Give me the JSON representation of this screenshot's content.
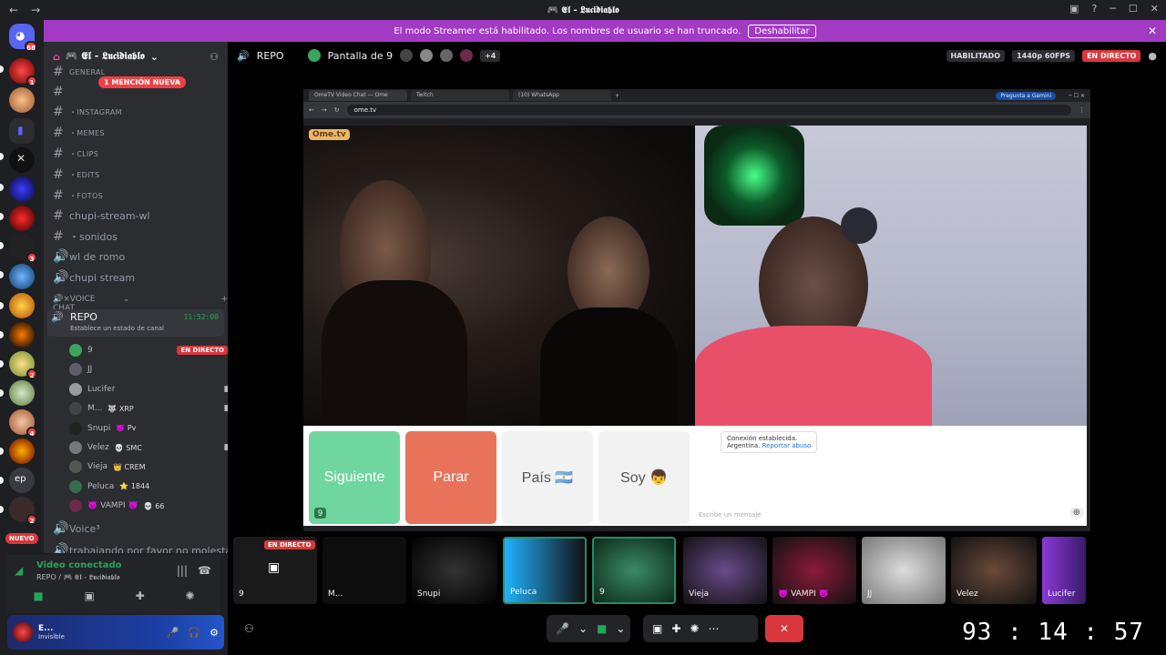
{
  "window": {
    "title": "🎮 𝕰𝖑 - 𝕷𝖚𝖈𝖎𝖉𝖎𝖆𝖇𝖑𝖔",
    "back": "←",
    "forward": "→"
  },
  "banner": {
    "text": "El modo Streamer está habilitado. Los nombres de usuario se han truncado.",
    "button": "Deshabilitar"
  },
  "rail": {
    "dm_badge": "68",
    "new_label": "NUEVO"
  },
  "guild": {
    "name": "🎮 𝕰𝖑 - 𝕷𝖚𝖈𝖎𝖉𝖎𝖆𝖇𝖑𝖔"
  },
  "mention_pill": "1 MENCIÓN NUEVA",
  "channels": [
    {
      "label": "GENERAL",
      "kind": "text",
      "small": true
    },
    {
      "label": "",
      "kind": "text",
      "small": true
    },
    {
      "label": "・INSTAGRAM",
      "kind": "text",
      "small": true
    },
    {
      "label": "・MEMES",
      "kind": "text",
      "small": true
    },
    {
      "label": "・CLIPS",
      "kind": "text",
      "small": true
    },
    {
      "label": "・EDITS",
      "kind": "text",
      "small": true
    },
    {
      "label": "・FOTOS",
      "kind": "text",
      "small": true
    },
    {
      "label": "chupi-stream-wl",
      "kind": "text",
      "small": false
    },
    {
      "label": "・sonidos",
      "kind": "text",
      "small": false
    },
    {
      "label": "wl de romo",
      "kind": "voice",
      "small": false
    },
    {
      "label": "chupi stream",
      "kind": "voice",
      "small": false
    }
  ],
  "voice_category": "🔊×VOICE CHAT",
  "active_voice": {
    "name": "REPO",
    "time": "11:52:00",
    "status": "Establece un estado de canal"
  },
  "members": [
    {
      "name": "9",
      "tag": "",
      "live": "EN DIRECTO",
      "cam": false,
      "color": "#3ba55c"
    },
    {
      "name": "JJ",
      "tag": "",
      "live": "",
      "cam": false,
      "color": "#5d6068"
    },
    {
      "name": "Lucifer",
      "tag": "",
      "live": "",
      "cam": true,
      "color": "#9a9aa0"
    },
    {
      "name": "M...",
      "tag": "🐺 XRP",
      "live": "",
      "cam": true,
      "color": "#444"
    },
    {
      "name": "Snupi",
      "tag": "👿 Pv",
      "live": "",
      "cam": false,
      "color": "#222"
    },
    {
      "name": "Velez",
      "tag": "💀 SMC",
      "live": "",
      "cam": true,
      "color": "#777"
    },
    {
      "name": "Vieja",
      "tag": "👑 CREM",
      "live": "",
      "cam": false,
      "color": "#555"
    },
    {
      "name": "Peluca",
      "tag": "⭐ 1844",
      "live": "",
      "cam": false,
      "color": "#3a6b4a"
    },
    {
      "name": "👿 VAMPI 👿",
      "tag": "💀 66",
      "live": "",
      "cam": false,
      "color": "#6b2a4a"
    }
  ],
  "after_voice": [
    {
      "label": "Voice³",
      "kind": "voice"
    },
    {
      "label": "trabajando por favor no molestar",
      "kind": "voice"
    }
  ],
  "connection": {
    "status": "Video conectado",
    "where": "REPO / 🎮 𝕰𝖑 - 𝕷𝖚𝖈𝖎𝖉𝖎𝖆𝖇𝖑𝖔"
  },
  "user": {
    "name": "E...",
    "status": "Invisible"
  },
  "topbar": {
    "channel": "REPO",
    "screen": "Pantalla de 9",
    "extra": "+4",
    "habilitado": "HABILITADO",
    "quality": "1440p 60FPS",
    "live": "EN DIRECTO"
  },
  "browser": {
    "tabs": [
      "OmeTV Video Chat — Ome",
      "Twitch",
      "(10) WhatsApp"
    ],
    "gemini": "Pregunta a Gemini",
    "url": "ome.tv",
    "logo": "Ome.tv"
  },
  "ome": {
    "buttons": {
      "next": "Siguiente",
      "stop": "Parar",
      "country": "País 🇦🇷",
      "me": "Soy 👦"
    },
    "count": "9",
    "chat_msg1": "Conexión establecida.",
    "chat_country": "Argentina.",
    "chat_report": "Reportar abuso",
    "chat_placeholder": "Escribe un mensaje"
  },
  "tiles": [
    {
      "label": "",
      "badge": "EN DIRECTO",
      "count": "9"
    },
    {
      "label": "M...",
      "badge": "",
      "count": ""
    },
    {
      "label": "Snupi",
      "badge": "",
      "count": ""
    },
    {
      "label": "Peluca",
      "badge": "",
      "count": ""
    },
    {
      "label": "9",
      "badge": "",
      "count": ""
    },
    {
      "label": "Vieja",
      "badge": "",
      "count": ""
    },
    {
      "label": "👿 VAMPI 👿",
      "badge": "",
      "count": ""
    },
    {
      "label": "JJ",
      "badge": "",
      "count": ""
    },
    {
      "label": "Velez",
      "badge": "",
      "count": ""
    },
    {
      "label": "Lucifer",
      "badge": "",
      "count": ""
    }
  ],
  "clock": "93 : 14 : 57"
}
